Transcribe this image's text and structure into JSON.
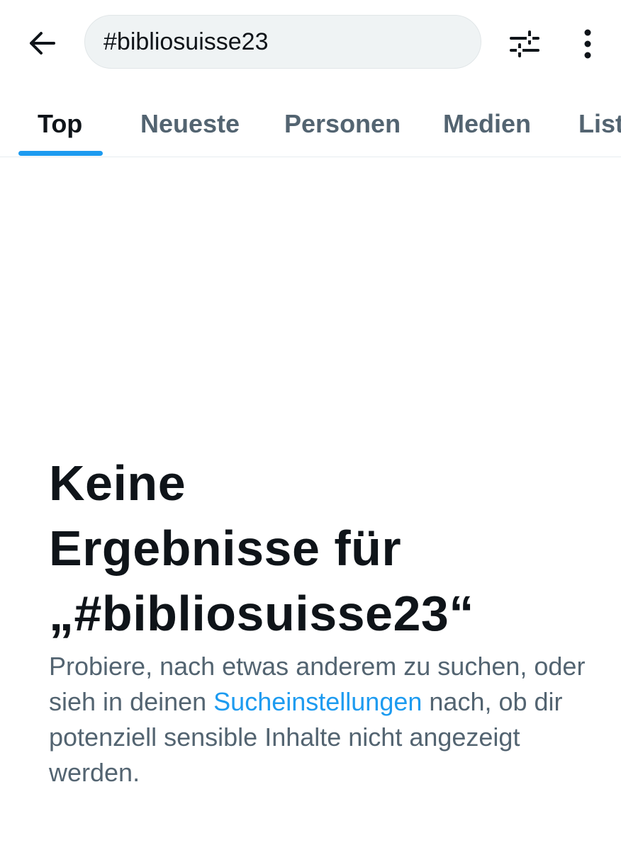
{
  "header": {
    "back_icon": "arrow-left-icon",
    "search": {
      "value": "#bibliosuisse23"
    },
    "filter_icon": "sliders-icon",
    "more_icon": "vertical-dots-icon"
  },
  "tabs": [
    {
      "label": "Top",
      "active": true
    },
    {
      "label": "Neueste",
      "active": false
    },
    {
      "label": "Personen",
      "active": false
    },
    {
      "label": "Medien",
      "active": false
    },
    {
      "label": "Listen",
      "active": false
    }
  ],
  "empty_state": {
    "title_line1": "Keine",
    "title_line2": "Ergebnisse für",
    "title_line3": "„#bibliosuisse23“",
    "text_before": "Probiere, nach etwas anderem zu suchen, oder sieh in deinen ",
    "link_label": "Sucheinstellungen",
    "text_after": " nach, ob dir potenziell sensible Inhalte nicht angezeigt werden."
  },
  "colors": {
    "accent": "#1d9bf0",
    "text_primary": "#0f1419",
    "text_secondary": "#536471",
    "search_bg": "#eff3f4",
    "divider": "#e6ecf0"
  }
}
